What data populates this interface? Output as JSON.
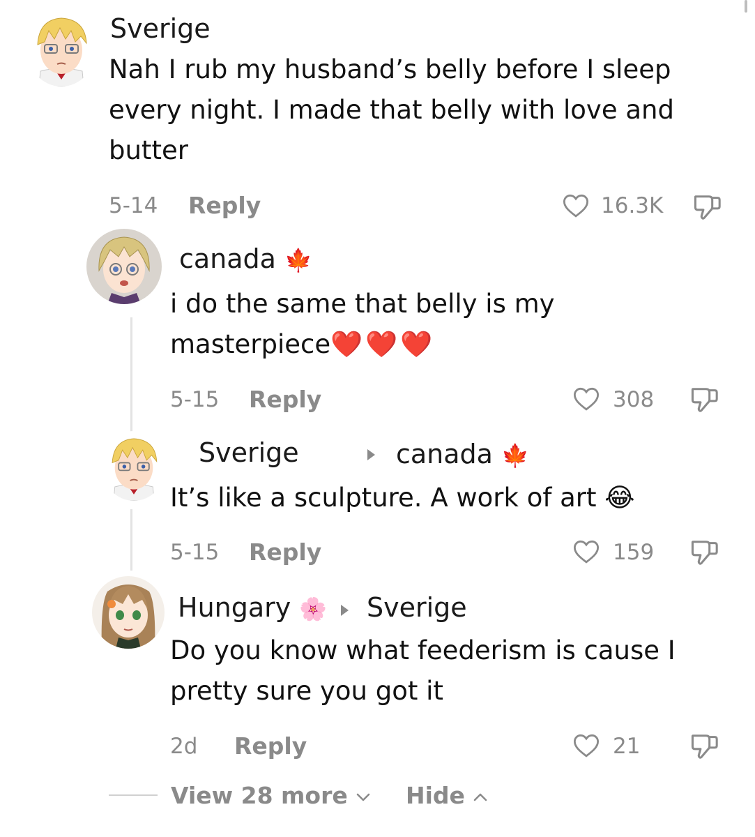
{
  "comments": [
    {
      "username": "Sverige",
      "text": "Nah I rub my husband’s belly before I sleep every night. I made that belly with love and butter",
      "date": "5-14",
      "reply_label": "Reply",
      "likes": "16.3K"
    },
    {
      "username": "canada",
      "username_emoji": "🍁",
      "text": "i do the same that belly is my masterpiece",
      "text_emoji": "❤️❤️❤️",
      "date": "5-15",
      "reply_label": "Reply",
      "likes": "308"
    },
    {
      "username": "Sverige",
      "reply_to": "canada",
      "reply_to_emoji": "🍁",
      "text": "It’s like a sculpture. A work of art",
      "text_emoji": "😂",
      "date": "5-15",
      "reply_label": "Reply",
      "likes": "159"
    },
    {
      "username": "Hungary",
      "username_emoji": "🌸",
      "reply_to": "Sverige",
      "text": "Do you know what feederism is cause I pretty sure you got it",
      "date": "2d",
      "reply_label": "Reply",
      "likes": "21"
    }
  ],
  "footer": {
    "view_more": "View 28 more",
    "hide": "Hide"
  },
  "icons": {
    "like": "heart-outline-icon",
    "dislike": "thumbs-down-outline-icon",
    "view_more_chevron": "chevron-down-icon",
    "hide_chevron": "chevron-up-icon"
  },
  "colors": {
    "meta_gray": "#8a8a8a",
    "heart_red": "#e0141e",
    "text": "#111111"
  }
}
